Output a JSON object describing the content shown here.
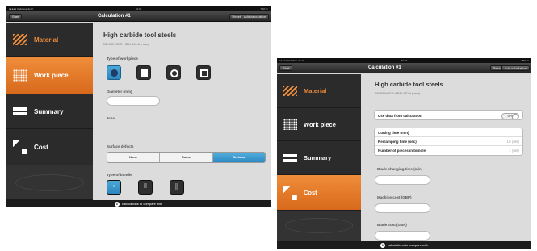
{
  "screen1": {
    "status": {
      "left": "●●●●● Vodafone.de ᯤ",
      "center": "10:43",
      "right": "75% ▭"
    },
    "nav": {
      "back_label": "Start",
      "title": "Calculation #1",
      "reset_label": "Reset",
      "add_label": "Add calculation"
    },
    "sidebar": [
      {
        "label": "Material",
        "icon": "stripes-icon"
      },
      {
        "label": "Work piece",
        "icon": "grid-icon"
      },
      {
        "label": "Summary",
        "icon": "list-icon"
      },
      {
        "label": "Cost",
        "icon": "cost-icon"
      },
      {
        "label": "",
        "icon": "fish-logo-icon"
      }
    ],
    "material_title": "High carbide tool steels",
    "material_sub": "BEHRINGER HBM 440 A (new)",
    "workpiece_type_label": "Type of workpiece",
    "workpiece_shapes": [
      "solid-round-icon",
      "solid-square-icon",
      "tube-round-icon",
      "tube-square-icon"
    ],
    "diameter_label": "Diameter (mm)",
    "diameter_value": "",
    "area_label": "Area",
    "surface_label": "Surface defects",
    "surface_options": [
      "None",
      "Some",
      "Serious"
    ],
    "surface_selected": "Serious",
    "bundle_label": "Type of bundle",
    "bundle_options": [
      "•",
      "⠿",
      "⣿"
    ],
    "footer_count": "0",
    "footer_text": "calculations to compare with"
  },
  "screen2": {
    "status": {
      "left": "●●●●● Vodafone.de ᯤ",
      "center": "10:43",
      "right": "75% ▭"
    },
    "nav": {
      "back_label": "Start",
      "title": "Calculation #1",
      "reset_label": "Reset",
      "add_label": "Add calculation"
    },
    "sidebar": [
      {
        "label": "Material",
        "icon": "stripes-icon"
      },
      {
        "label": "Work piece",
        "icon": "grid-icon"
      },
      {
        "label": "Summary",
        "icon": "list-icon"
      },
      {
        "label": "Cost",
        "icon": "cost-icon"
      },
      {
        "label": "",
        "icon": "fish-logo-icon"
      }
    ],
    "material_title": "High carbide tool steels",
    "material_sub": "BEHRINGER HBM 440 A (new)",
    "use_data_label": "Use data from calculation",
    "toggle_label": "OFF",
    "rows": [
      {
        "label": "Cutting time (min)",
        "value": ""
      },
      {
        "label": "Reclamping time (sec)",
        "value": "10 (def)"
      },
      {
        "label": "Number of pieces in bundle",
        "value": "1 (def)"
      }
    ],
    "blade_time_label": "Blade changing time (min)",
    "machine_cost_label": "Machine cost (GBP)",
    "blade_cost_label": "Blade cost (GBP)",
    "footer_count": "0",
    "footer_text": "calculations to compare with"
  }
}
